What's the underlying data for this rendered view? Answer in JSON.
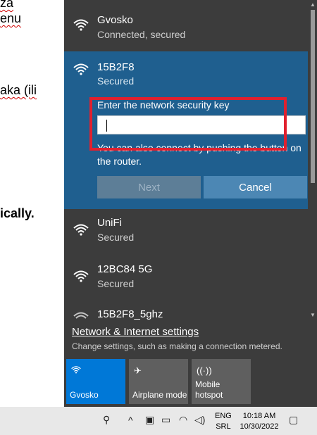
{
  "document": {
    "lines": [
      "za",
      "enu",
      "aka (ili",
      "ically."
    ]
  },
  "flyout": {
    "networks": [
      {
        "name": "Gvosko",
        "status": "Connected, secured"
      },
      {
        "name": "15B2F8",
        "status": "Secured"
      },
      {
        "name": "UniFi",
        "status": "Secured"
      },
      {
        "name": "12BC84 5G",
        "status": "Secured"
      },
      {
        "name": "15B2F8_5ghz",
        "status": ""
      }
    ],
    "selected": {
      "key_label": "Enter the network security key",
      "key_value": "",
      "hint": "You can also connect by pushing the button on the router.",
      "next_label": "Next",
      "cancel_label": "Cancel"
    },
    "settings_link": "Network & Internet settings",
    "settings_desc": "Change settings, such as making a connection metered.",
    "tiles": [
      {
        "label": "Gvosko",
        "icon": "wifi-icon",
        "active": true
      },
      {
        "label": "Airplane mode",
        "icon": "airplane-icon",
        "active": false
      },
      {
        "label": "Mobile hotspot",
        "icon": "hotspot-icon",
        "active": false
      }
    ]
  },
  "taskbar": {
    "lang_top": "ENG",
    "lang_bottom": "SRL",
    "time": "10:18 AM",
    "date": "10/30/2022"
  },
  "colors": {
    "flyout_bg": "#3c3c3c",
    "selected_bg": "#1f5f8f",
    "accent": "#0078d7",
    "highlight_box": "#e0202e"
  }
}
